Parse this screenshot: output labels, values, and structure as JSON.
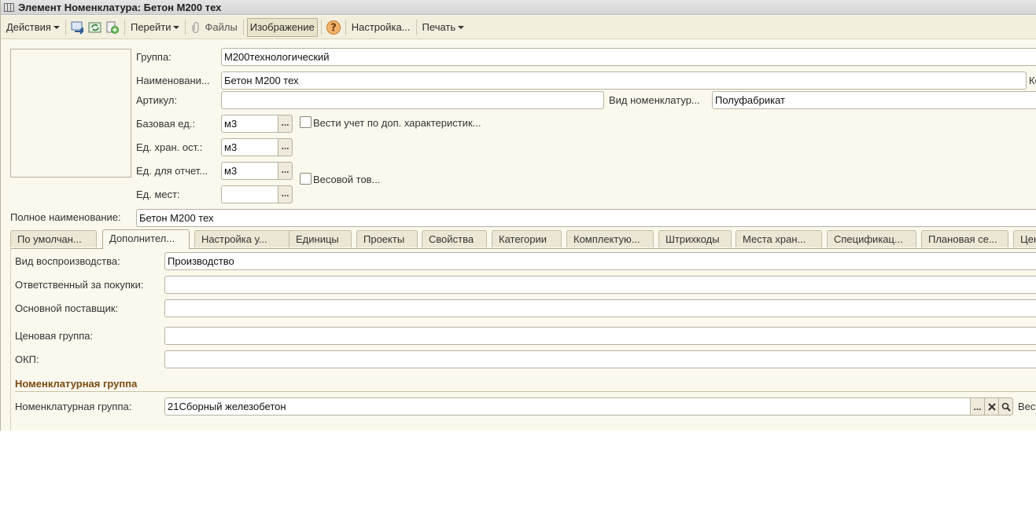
{
  "window": {
    "title": "Элемент Номенклатура: Бетон М200 тех"
  },
  "toolbar": {
    "actions": "Действия",
    "goto": "Перейти",
    "files": "Файлы",
    "image": "Изображение",
    "settings": "Настройка...",
    "print": "Печать"
  },
  "header": {
    "group_label": "Группа:",
    "group_value": "М200технологический",
    "name_label": "Наименовани...",
    "name_value": "Бетон М200 тех",
    "name_right_clip": "Ко",
    "article_label": "Артикул:",
    "article_value": "",
    "kind_label": "Вид номенклатур...",
    "kind_value": "Полуфабрикат",
    "base_unit_label": "Базовая ед.:",
    "base_unit_value": "м3",
    "extra_char_label": "Вести учет по доп. характеристик...",
    "storage_unit_label": "Ед. хран. ост.:",
    "storage_unit_value": "м3",
    "report_unit_label": "Ед. для отчет...",
    "report_unit_value": "м3",
    "weight_label": "Весовой тов...",
    "places_unit_label": "Ед. мест:",
    "places_unit_value": "",
    "full_name_label": "Полное наименование:",
    "full_name_value": "Бетон М200 тех"
  },
  "tabs": [
    {
      "label": "По умолчан..."
    },
    {
      "label": "Дополнител...",
      "active": true
    },
    {
      "label": "Настройка у..."
    },
    {
      "label": "Единицы"
    },
    {
      "label": "Проекты"
    },
    {
      "label": "Свойства"
    },
    {
      "label": "Категории"
    },
    {
      "label": "Комплектую..."
    },
    {
      "label": "Штрихкоды"
    },
    {
      "label": "Места хран..."
    },
    {
      "label": "Спецификац..."
    },
    {
      "label": "Плановая се..."
    },
    {
      "label": "Цен"
    }
  ],
  "panel": {
    "reproduction_label": "Вид воспроизводства:",
    "reproduction_value": "Производство",
    "responsible_label": "Ответственный за покупки:",
    "responsible_value": "",
    "supplier_label": "Основной поставщик:",
    "supplier_value": "",
    "price_group_label": "Ценовая группа:",
    "price_group_value": "",
    "okp_label": "ОКП:",
    "okp_value": "",
    "section_title": "Номенклатурная группа",
    "nom_group_label": "Номенклатурная группа:",
    "nom_group_value": "21Сборный железобетон",
    "nom_group_right_clip": "Вес"
  }
}
